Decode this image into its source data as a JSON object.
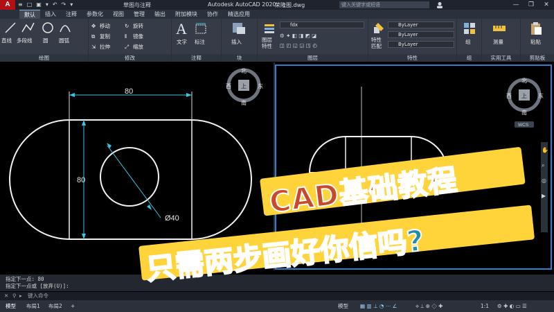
{
  "titlebar": {
    "logo": "A",
    "qat": [
      "≡",
      "□",
      "▣",
      "▾",
      "↶",
      "↷",
      "▾"
    ],
    "workspace": "草图与注释",
    "app_title": "Autodesk AutoCAD 2020",
    "doc_name": "荣隆图.dwg",
    "search_placeholder": "键入关键字或短语",
    "user_icon": "user-icon",
    "window_buttons": [
      "—",
      "❐",
      "✕"
    ]
  },
  "ribbon_tabs": [
    "默认",
    "插入",
    "注释",
    "参数化",
    "视图",
    "管理",
    "输出",
    "附加模块",
    "协作",
    "精选应用"
  ],
  "ribbon": {
    "draw": {
      "title": "绘图",
      "line": "直线",
      "polyline": "多段线",
      "circle": "圆",
      "arc": "圆弧"
    },
    "modify": {
      "title": "修改",
      "items": [
        "移动",
        "旋转",
        "复制",
        "镜像",
        "拉伸",
        "缩放"
      ]
    },
    "annotation": {
      "title": "注释",
      "text": "文字",
      "dimension": "标注"
    },
    "block": {
      "title": "块",
      "insert": "插入"
    },
    "layers": {
      "title": "图层",
      "layer_props": "图层\n特性",
      "layer_name": "fdx"
    },
    "properties": {
      "title": "特性",
      "match": "特性\n匹配",
      "bylayer1": "ByLayer",
      "bylayer2": "ByLayer",
      "bylayer3": "ByLayer"
    },
    "groups": {
      "title": "组",
      "label": "组"
    },
    "utilities": {
      "title": "实用工具",
      "measure": "测量"
    },
    "clipboard": {
      "title": "剪贴板",
      "paste": "粘贴"
    }
  },
  "drawing_left": {
    "dim_top": "80",
    "dim_left": "80",
    "dim_circle": "Ø40",
    "viewcube": {
      "n": "北",
      "s": "南",
      "e": "东",
      "w": "西",
      "top": "上"
    }
  },
  "drawing_right": {
    "viewcube": {
      "n": "北",
      "s": "南",
      "e": "东",
      "w": "西",
      "top": "上",
      "wcs": "WCS"
    },
    "ucs_y": "Y"
  },
  "command": {
    "line1": "指定下一点:  80",
    "line2": "指定下一点或 [放弃(U)]:",
    "prompt": "键入命令"
  },
  "status": {
    "layout_tabs": [
      "模型",
      "布局1",
      "布局2"
    ],
    "model": "模型",
    "scale": "1:1"
  },
  "overlay": {
    "title1": "CAD基础教程",
    "title2": "只需两步画好你信吗?"
  },
  "colors": {
    "accent_blue": "#2f7fd0",
    "dim_cyan": "#37c8e6",
    "title_orange": "#c9492c",
    "title_teal": "#1f8fa8",
    "title_bg": "#ffd43a"
  }
}
